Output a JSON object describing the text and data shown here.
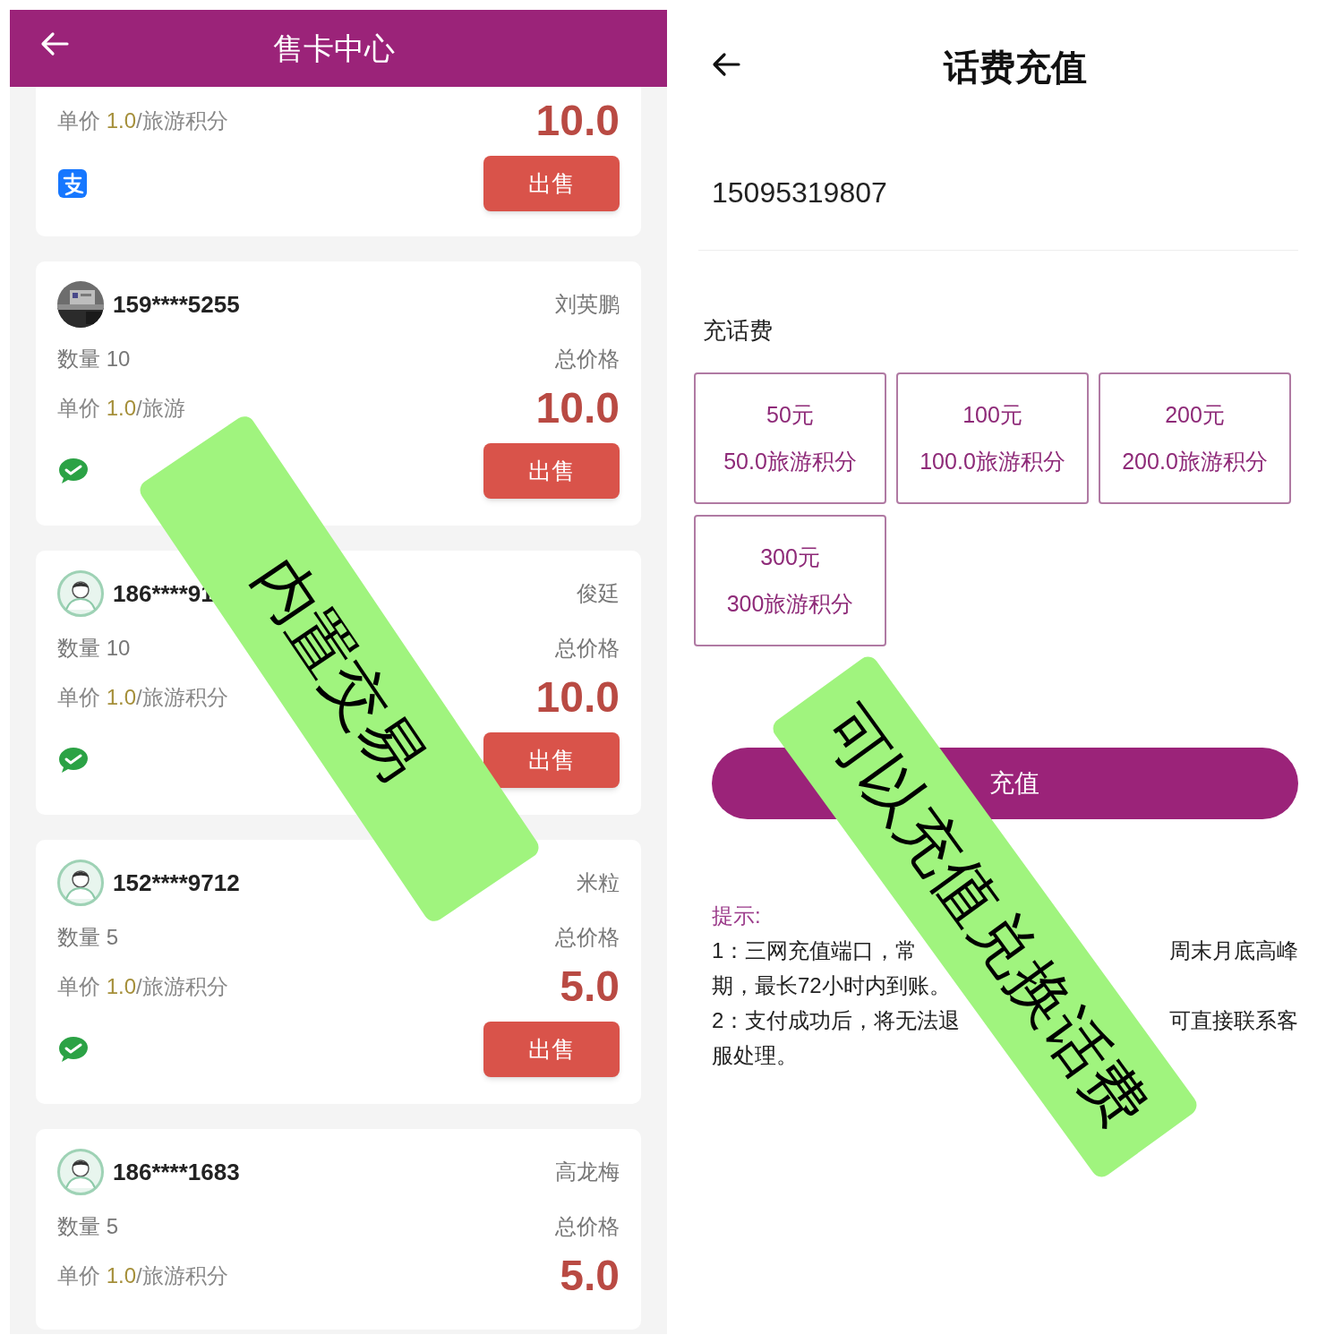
{
  "left": {
    "header": {
      "title": "售卡中心"
    },
    "listings": [
      {
        "price_label": "单价",
        "price_value": "1.0",
        "price_unit": "/旅游积分",
        "total": "10.0",
        "pay": {
          "kind": "alipay"
        },
        "button": "出售"
      },
      {
        "phone": "159****5255",
        "seller": "刘英鹏",
        "qty": "数量 10",
        "total_label": "总价格",
        "price_label": "单价",
        "price_value": "1.0",
        "price_unit": "/旅游",
        "total": "10.0",
        "pay": {
          "kind": "wechat"
        },
        "button": "出售"
      },
      {
        "avatar": {
          "kind": "default"
        },
        "phone": "186****91",
        "seller": "俊廷",
        "qty": "数量 10",
        "total_label": "总价格",
        "price_label": "单价",
        "price_value": "1.0",
        "price_unit": "/旅游积分",
        "total": "10.0",
        "pay": {
          "kind": "wechat"
        },
        "button": "出售"
      },
      {
        "avatar": {
          "kind": "default"
        },
        "phone": "152****9712",
        "seller": "米粒",
        "qty": "数量 5",
        "total_label": "总价格",
        "price_label": "单价",
        "price_value": "1.0",
        "price_unit": "/旅游积分",
        "total": "5.0",
        "pay": {
          "kind": "wechat"
        },
        "button": "出售"
      },
      {
        "avatar": {
          "kind": "default"
        },
        "phone": "186****1683",
        "seller": "高龙梅",
        "qty": "数量 5",
        "total_label": "总价格",
        "price_label": "单价",
        "price_value": "1.0",
        "price_unit": "/旅游积分",
        "total": "5.0"
      }
    ]
  },
  "right": {
    "title": "话费充值",
    "phone": "15095319807",
    "section": "充话费",
    "options": [
      {
        "amount": "50元",
        "points": "50.0旅游积分"
      },
      {
        "amount": "100元",
        "points": "100.0旅游积分"
      },
      {
        "amount": "200元",
        "points": "200.0旅游积分"
      },
      {
        "amount": "300元",
        "points": "300旅游积分"
      }
    ],
    "submit": "充值",
    "tips": {
      "heading": "提示:",
      "lines": [
        {
          "left": "1：三网充值端口，常",
          "right": "周末月底高峰"
        },
        {
          "left": "期，最长72小时内到账。"
        },
        {
          "left": "2：支付成功后，将无法退",
          "right": "可直接联系客"
        },
        {
          "left": "服处理。"
        }
      ]
    }
  },
  "stickers": [
    {
      "text": "内置交易"
    },
    {
      "text": "可以充值兑换话费"
    }
  ]
}
